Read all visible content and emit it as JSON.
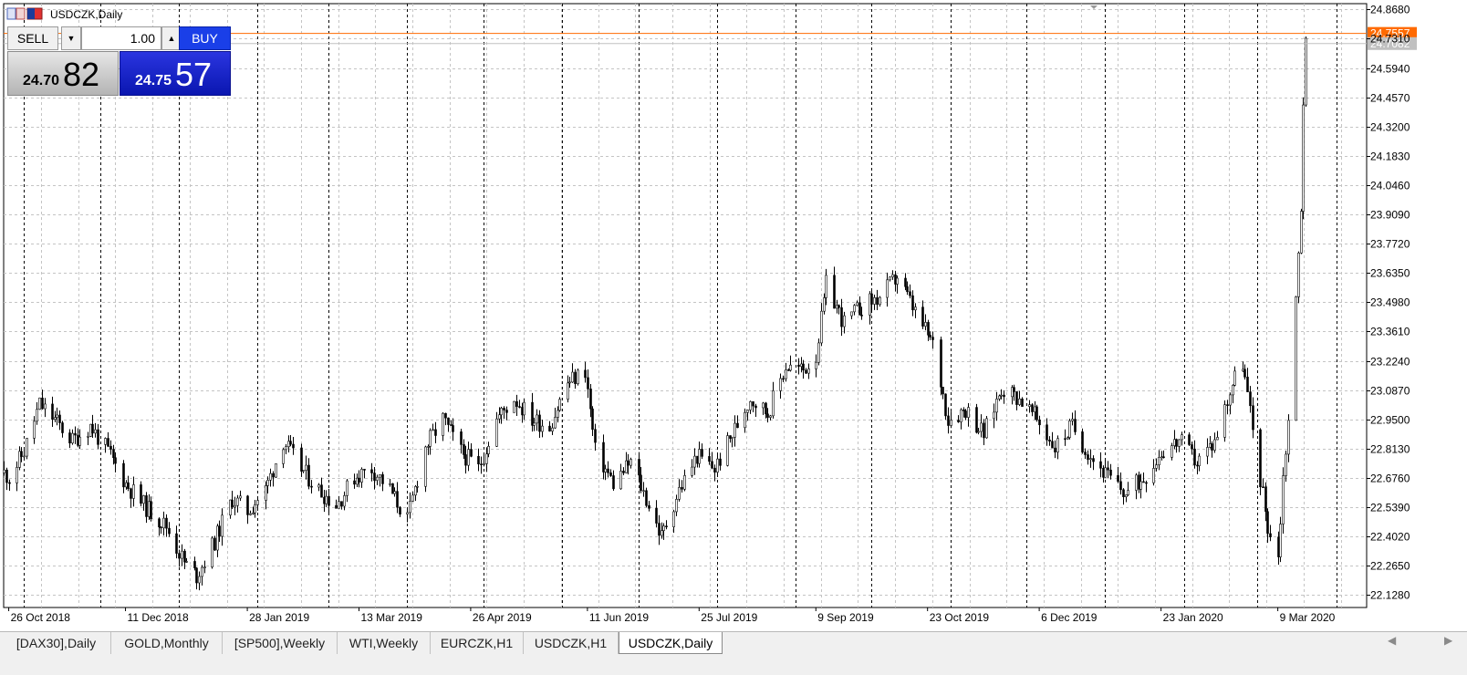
{
  "symbol_label": "USDCZK,Daily",
  "trade_panel": {
    "sell_label": "SELL",
    "buy_label": "BUY",
    "lot": "1.00",
    "sell_price_small": "24.70",
    "sell_price_big": "82",
    "buy_price_small": "24.75",
    "buy_price_big": "57"
  },
  "tabs": [
    {
      "label": "[DAX30],Daily",
      "active": false
    },
    {
      "label": "GOLD,Monthly",
      "active": false
    },
    {
      "label": "[SP500],Weekly",
      "active": false
    },
    {
      "label": "WTI,Weekly",
      "active": false
    },
    {
      "label": "EURCZK,H1",
      "active": false
    },
    {
      "label": "USDCZK,H1",
      "active": false
    },
    {
      "label": "USDCZK,Daily",
      "active": true
    }
  ],
  "colors": {
    "ask_line": "#ff6a00",
    "bid_line": "#c0c0c0",
    "buy_accent": "#1a3fe8",
    "candle": "#000000"
  },
  "chart_data": {
    "type": "candlestick",
    "symbol": "USDCZK",
    "timeframe": "Daily",
    "y_ticks": [
      "24.8680",
      "24.7310",
      "24.5940",
      "24.4570",
      "24.3200",
      "24.1830",
      "24.0460",
      "23.9090",
      "23.7720",
      "23.6350",
      "23.4980",
      "23.3610",
      "23.2240",
      "23.0870",
      "22.9500",
      "22.8130",
      "22.6760",
      "22.5390",
      "22.4020",
      "22.2650",
      "22.1280"
    ],
    "x_ticks": [
      "26 Oct 2018",
      "11 Dec 2018",
      "28 Jan 2019",
      "13 Mar 2019",
      "26 Apr 2019",
      "11 Jun 2019",
      "25 Jul 2019",
      "9 Sep 2019",
      "23 Oct 2019",
      "6 Dec 2019",
      "23 Jan 2020",
      "9 Mar 2020"
    ],
    "ask_price": "24.7557",
    "bid_price": "24.7082",
    "ylim": [
      22.07,
      24.895
    ],
    "grid": true,
    "close_points": [
      [
        "2018-10-24",
        22.7
      ],
      [
        "2018-10-26",
        22.68
      ],
      [
        "2018-11-01",
        22.8
      ],
      [
        "2018-11-07",
        23.02
      ],
      [
        "2018-11-13",
        22.95
      ],
      [
        "2018-11-20",
        22.85
      ],
      [
        "2018-11-27",
        22.92
      ],
      [
        "2018-12-04",
        22.8
      ],
      [
        "2018-12-11",
        22.65
      ],
      [
        "2018-12-18",
        22.55
      ],
      [
        "2018-12-27",
        22.45
      ],
      [
        "2019-01-03",
        22.28
      ],
      [
        "2019-01-08",
        22.22
      ],
      [
        "2019-01-15",
        22.38
      ],
      [
        "2019-01-22",
        22.58
      ],
      [
        "2019-01-28",
        22.52
      ],
      [
        "2019-02-04",
        22.62
      ],
      [
        "2019-02-11",
        22.85
      ],
      [
        "2019-02-18",
        22.72
      ],
      [
        "2019-02-25",
        22.62
      ],
      [
        "2019-03-04",
        22.55
      ],
      [
        "2019-03-11",
        22.68
      ],
      [
        "2019-03-18",
        22.72
      ],
      [
        "2019-03-25",
        22.62
      ],
      [
        "2019-04-01",
        22.48
      ],
      [
        "2019-04-08",
        22.82
      ],
      [
        "2019-04-15",
        22.95
      ],
      [
        "2019-04-22",
        22.8
      ],
      [
        "2019-04-29",
        22.72
      ],
      [
        "2019-05-06",
        22.95
      ],
      [
        "2019-05-13",
        23.05
      ],
      [
        "2019-05-20",
        22.95
      ],
      [
        "2019-05-27",
        22.92
      ],
      [
        "2019-06-03",
        23.12
      ],
      [
        "2019-06-10",
        23.18
      ],
      [
        "2019-06-14",
        22.8
      ],
      [
        "2019-06-21",
        22.65
      ],
      [
        "2019-06-28",
        22.75
      ],
      [
        "2019-07-05",
        22.55
      ],
      [
        "2019-07-10",
        22.4
      ],
      [
        "2019-07-17",
        22.62
      ],
      [
        "2019-07-24",
        22.78
      ],
      [
        "2019-07-31",
        22.72
      ],
      [
        "2019-08-07",
        22.88
      ],
      [
        "2019-08-14",
        23.05
      ],
      [
        "2019-08-21",
        22.98
      ],
      [
        "2019-08-28",
        23.2
      ],
      [
        "2019-09-04",
        23.18
      ],
      [
        "2019-09-09",
        23.25
      ],
      [
        "2019-09-13",
        23.58
      ],
      [
        "2019-09-20",
        23.4
      ],
      [
        "2019-09-27",
        23.48
      ],
      [
        "2019-10-04",
        23.52
      ],
      [
        "2019-10-11",
        23.62
      ],
      [
        "2019-10-18",
        23.45
      ],
      [
        "2019-10-25",
        23.3
      ],
      [
        "2019-10-31",
        22.95
      ],
      [
        "2019-11-07",
        23.0
      ],
      [
        "2019-11-14",
        22.88
      ],
      [
        "2019-11-21",
        23.1
      ],
      [
        "2019-11-28",
        23.05
      ],
      [
        "2019-12-05",
        22.95
      ],
      [
        "2019-12-12",
        22.82
      ],
      [
        "2019-12-19",
        22.92
      ],
      [
        "2019-12-26",
        22.78
      ],
      [
        "2020-01-02",
        22.68
      ],
      [
        "2020-01-09",
        22.6
      ],
      [
        "2020-01-16",
        22.68
      ],
      [
        "2020-01-23",
        22.8
      ],
      [
        "2020-01-30",
        22.85
      ],
      [
        "2020-02-06",
        22.75
      ],
      [
        "2020-02-13",
        22.85
      ],
      [
        "2020-02-20",
        23.12
      ],
      [
        "2020-02-24",
        23.22
      ],
      [
        "2020-02-28",
        22.9
      ],
      [
        "2020-03-03",
        22.6
      ],
      [
        "2020-03-05",
        22.45
      ],
      [
        "2020-03-09",
        22.3
      ],
      [
        "2020-03-11",
        22.68
      ],
      [
        "2020-03-13",
        22.95
      ],
      [
        "2020-03-16",
        23.5
      ],
      [
        "2020-03-18",
        23.95
      ],
      [
        "2020-03-19",
        24.45
      ],
      [
        "2020-03-20",
        24.7
      ]
    ]
  }
}
